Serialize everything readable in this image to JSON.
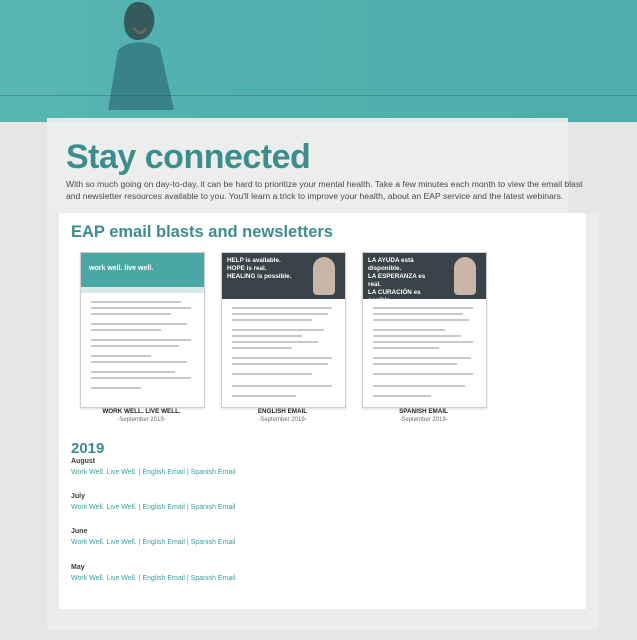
{
  "page": {
    "title": "Stay connected",
    "intro": "With so much going on day-to-day, it can be hard to prioritize your mental health. Take a few minutes each month to view the email blast and newsletter resources available to you. You'll learn a trick to improve your health, about an EAP service and the latest webinars."
  },
  "colors": {
    "accent": "#3b8e8b",
    "hero": "#4fb0ad",
    "link": "#3b9f9c"
  },
  "section": {
    "title": "EAP email blasts and newsletters"
  },
  "thumbnails": [
    {
      "label": "WORK WELL. LIVE WELL.",
      "date": "-September 2019-",
      "header_text": "work well. live well."
    },
    {
      "label": "ENGLISH EMAIL",
      "date": "-September 2019-",
      "header_lines": [
        "HELP is available.",
        "HOPE is real.",
        "HEALING is possible."
      ]
    },
    {
      "label": "SPANISH EMAIL",
      "date": "-September 2019-",
      "header_lines": [
        "LA AYUDA está disponible.",
        "LA ESPERANZA es real.",
        "LA CURACIÓN es posible."
      ]
    }
  ],
  "archive": {
    "year": "2019",
    "months": [
      {
        "name": "August",
        "links": [
          "Work Well. Live Well.",
          "English Email",
          "Spanish Email"
        ]
      },
      {
        "name": "July",
        "links": [
          "Work Well. Live Well.",
          "English Email",
          "Spanish Email"
        ]
      },
      {
        "name": "June",
        "links": [
          "Work Well. Live Well.",
          "English Email",
          "Spanish Email"
        ]
      },
      {
        "name": "May",
        "links": [
          "Work Well. Live Well.",
          "English Email",
          "Spanish Email"
        ]
      }
    ],
    "separator": "|"
  }
}
